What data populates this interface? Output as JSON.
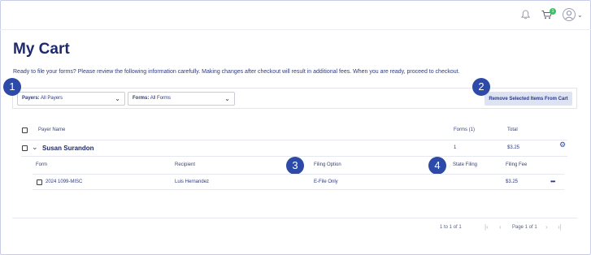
{
  "cart_badge": "1",
  "page_title": "My Cart",
  "intro": "Ready to file your forms? Please review the following information carefully. Making changes after checkout will result in additional fees. When you are ready, proceed to checkout.",
  "filters": {
    "payers_label": "Payers:",
    "payers_value": "All Payers",
    "forms_label": "Forms:",
    "forms_value": "All Forms",
    "remove_button": "Remove Selected Items From Cart"
  },
  "callouts": [
    "1",
    "2",
    "3",
    "4"
  ],
  "table": {
    "headers": {
      "payer_name": "Payer Name",
      "forms": "Forms (1)",
      "total": "Total"
    },
    "payer": {
      "name": "Susan Surandon",
      "forms": "1",
      "total": "$3.25"
    },
    "sub_headers": {
      "form": "Form",
      "recipient": "Recipient",
      "filing_option": "Filing Option",
      "state_filing": "State Filing",
      "filing_fee": "Filing Fee"
    },
    "rows": [
      {
        "form": "2024 1099-MISC",
        "recipient": "Luis Hernandez",
        "filing_option": "E-File Only",
        "state_filing": "",
        "filing_fee": "$3.25"
      }
    ]
  },
  "pagination": {
    "range": "1 to 1 of 1",
    "page": "Page 1 of 1"
  },
  "colors": {
    "accent": "#2d4aa8",
    "text": "#1f2a6b",
    "badge": "#3ebf6a",
    "button_bg": "#dde3f3"
  }
}
